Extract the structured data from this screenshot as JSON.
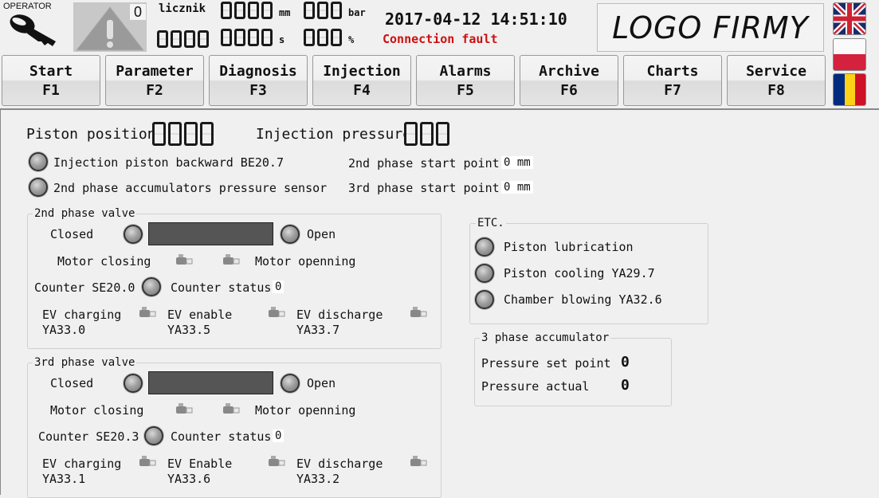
{
  "header": {
    "operator_label": "OPERATOR",
    "alarm_count": "0",
    "counter_label": "licznik",
    "displays": [
      {
        "name": "counter-top",
        "digits": 4,
        "unit": "mm"
      },
      {
        "name": "pressure-top",
        "digits": 3,
        "unit": "bar"
      },
      {
        "name": "counter-bottom",
        "digits": 4,
        "unit": ""
      },
      {
        "name": "time-display",
        "digits": 4,
        "unit": "s"
      },
      {
        "name": "percent-display",
        "digits": 3,
        "unit": "%"
      }
    ],
    "units": {
      "mm": "mm",
      "bar": "bar",
      "s": "s",
      "percent": "%"
    },
    "datetime": "2017-04-12 14:51:10",
    "connection_status": "Connection fault",
    "connection_color": "#cc1111",
    "logo_text": "LOGO FIRMY",
    "languages": [
      "english",
      "polish",
      "romanian"
    ]
  },
  "nav": [
    {
      "label": "Start",
      "key": "F1"
    },
    {
      "label": "Parameter",
      "key": "F2"
    },
    {
      "label": "Diagnosis",
      "key": "F3"
    },
    {
      "label": "Injection",
      "key": "F4"
    },
    {
      "label": "Alarms",
      "key": "F5"
    },
    {
      "label": "Archive",
      "key": "F6"
    },
    {
      "label": "Charts",
      "key": "F7"
    },
    {
      "label": "Service",
      "key": "F8"
    }
  ],
  "main": {
    "piston_position_label": "Piston position",
    "injection_pressure_label": "Injection pressure",
    "injection_piston_backward": "Injection piston backward BE20.7",
    "accumulators_pressure_sensor": "2nd phase accumulators pressure sensor",
    "phase2_start_label": "2nd phase start point",
    "phase2_start_value": "0 mm",
    "phase3_start_label": "3rd phase start point",
    "phase3_start_value": "0 mm",
    "valve2": {
      "title": "2nd phase valve",
      "closed": "Closed",
      "open": "Open",
      "motor_closing": "Motor closing",
      "motor_opening": "Motor openning",
      "counter_label": "Counter SE20.0",
      "counter_status_label": "Counter status",
      "counter_status_value": "0",
      "ev_charging": "EV charging",
      "ev_charging_code": "YA33.0",
      "ev_enable": "EV enable",
      "ev_enable_code": "YA33.5",
      "ev_discharge": "EV discharge",
      "ev_discharge_code": "YA33.7"
    },
    "valve3": {
      "title": "3rd phase valve",
      "closed": "Closed",
      "open": "Open",
      "motor_closing": "Motor closing",
      "motor_opening": "Motor openning",
      "counter_label": "Counter SE20.3",
      "counter_status_label": "Counter status",
      "counter_status_value": "0",
      "ev_charging": "EV charging",
      "ev_charging_code": "YA33.1",
      "ev_enable": "EV Enable",
      "ev_enable_code": "YA33.6",
      "ev_discharge": "EV discharge",
      "ev_discharge_code": "YA33.2"
    },
    "etc": {
      "title": "ETC.",
      "items": [
        "Piston lubrication",
        "Piston cooling YA29.7",
        "Chamber blowing YA32.6"
      ]
    },
    "accumulator": {
      "title": "3 phase accumulator",
      "set_point_label": "Pressure set point",
      "set_point_value": "0",
      "actual_label": "Pressure actual",
      "actual_value": "0"
    }
  }
}
